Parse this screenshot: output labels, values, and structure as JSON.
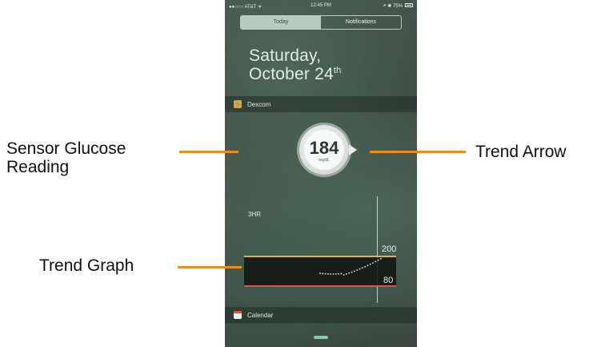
{
  "status_bar": {
    "carrier": "●●○○○ AT&T ᯤ",
    "time": "12:45 PM",
    "right": "⬏ ✱ 75%",
    "battery_fraction": 0.75
  },
  "tabs": [
    {
      "label": "Today",
      "active": true
    },
    {
      "label": "Notifications",
      "active": false
    }
  ],
  "date": {
    "day": "Saturday,",
    "month": "October 24",
    "suffix": "th"
  },
  "dexcom_widget": {
    "app_name": "Dexcom",
    "glucose_value": "184",
    "unit": "mg/dL",
    "graph_range": "3HR",
    "high_label": "200",
    "low_label": "80",
    "colors": {
      "high_line": "#e3b23c",
      "low_line": "#d9534f"
    }
  },
  "calendar_widget": {
    "app_name": "Calendar"
  },
  "callouts": {
    "sensor_reading": [
      "Sensor Glucose",
      "Reading"
    ],
    "trend_arrow": "Trend Arrow",
    "trend_graph": "Trend Graph",
    "color": "#f08a1d"
  }
}
